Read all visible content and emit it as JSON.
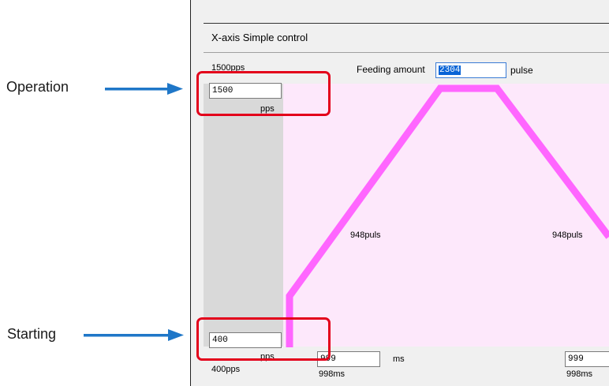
{
  "window": {
    "title": "X-axis Simple control"
  },
  "speed_labels": {
    "max": "1500pps",
    "min": "400pps",
    "unit_operation": "pps",
    "unit_starting": "pps"
  },
  "feeding": {
    "label": "Feeding amount",
    "value": "2304",
    "unit": "pulse"
  },
  "operation_speed": {
    "value": "1500"
  },
  "starting_speed": {
    "value": "400"
  },
  "segments": {
    "accel_pulses": "948puls",
    "decel_pulses": "948puls"
  },
  "time_fields": {
    "accel_value": "999",
    "accel_unit": "ms",
    "accel_readout": "998ms",
    "decel_value": "999",
    "decel_readout": "998ms"
  },
  "annotations": {
    "operation": "Operation",
    "starting": "Starting"
  },
  "colors": {
    "profile_line": "#ff66ff",
    "highlight_box": "#e3001b",
    "arrow": "#1f77c8",
    "plot_background": "#fde8fb"
  }
}
